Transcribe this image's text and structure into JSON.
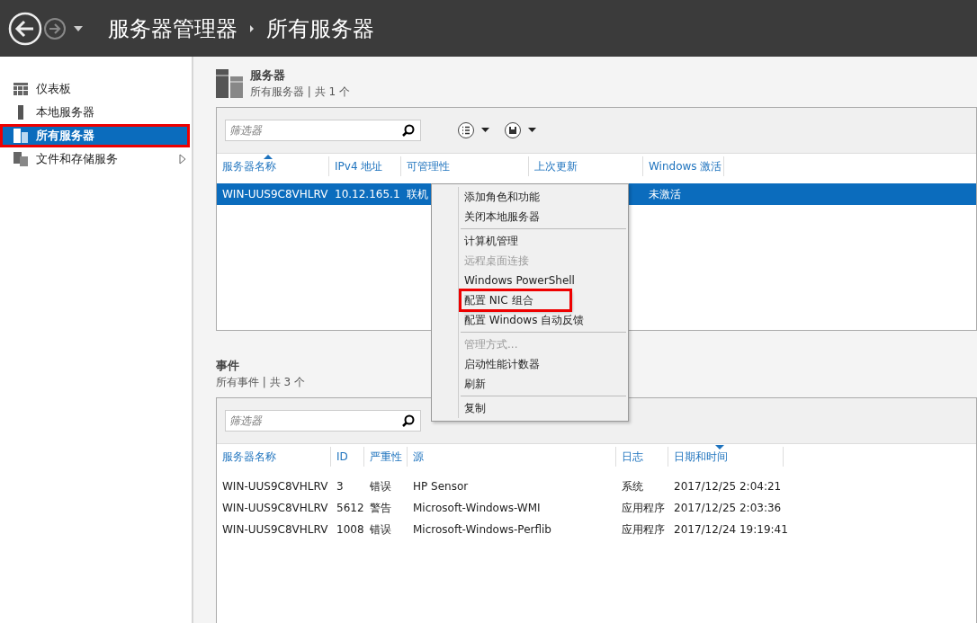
{
  "header": {
    "breadcrumb": [
      "服务器管理器",
      "所有服务器"
    ]
  },
  "sidebar": {
    "items": [
      {
        "label": "仪表板",
        "selected": false,
        "highlighted": false,
        "expandable": false
      },
      {
        "label": "本地服务器",
        "selected": false,
        "highlighted": false,
        "expandable": false
      },
      {
        "label": "所有服务器",
        "selected": true,
        "highlighted": true,
        "expandable": false
      },
      {
        "label": "文件和存储服务",
        "selected": false,
        "highlighted": false,
        "expandable": true
      }
    ]
  },
  "servers": {
    "title": "服务器",
    "subtitle": "所有服务器 | 共 1 个",
    "filter": {
      "placeholder": "筛选器"
    },
    "columns": [
      "服务器名称",
      "IPv4 地址",
      "可管理性",
      "上次更新",
      "Windows 激活"
    ],
    "rows": [
      {
        "cells": [
          "WIN-UUS9C8VHLRV",
          "10.12.165.1",
          "联机",
          "",
          "未激活"
        ],
        "selected": true
      }
    ]
  },
  "context_menu": {
    "groups": [
      [
        {
          "label": "添加角色和功能",
          "disabled": false,
          "highlighted": false
        },
        {
          "label": "关闭本地服务器",
          "disabled": false,
          "highlighted": false
        }
      ],
      [
        {
          "label": "计算机管理",
          "disabled": false,
          "highlighted": false
        },
        {
          "label": "远程桌面连接",
          "disabled": true,
          "highlighted": false
        },
        {
          "label": "Windows PowerShell",
          "disabled": false,
          "highlighted": false
        },
        {
          "label": "配置 NIC 组合",
          "disabled": false,
          "highlighted": true
        },
        {
          "label": "配置 Windows 自动反馈",
          "disabled": false,
          "highlighted": false
        }
      ],
      [
        {
          "label": "管理方式...",
          "disabled": true,
          "highlighted": false
        },
        {
          "label": "启动性能计数器",
          "disabled": false,
          "highlighted": false
        },
        {
          "label": "刷新",
          "disabled": false,
          "highlighted": false
        }
      ],
      [
        {
          "label": "复制",
          "disabled": false,
          "highlighted": false
        }
      ]
    ]
  },
  "events": {
    "title": "事件",
    "subtitle": "所有事件 | 共 3 个",
    "filter": {
      "placeholder": "筛选器"
    },
    "columns": [
      "服务器名称",
      "ID",
      "严重性",
      "源",
      "日志",
      "日期和时间"
    ],
    "rows": [
      {
        "cells": [
          "WIN-UUS9C8VHLRV",
          "3",
          "错误",
          "HP Sensor",
          "系统",
          "2017/12/25 2:04:21"
        ],
        "selected": false
      },
      {
        "cells": [
          "WIN-UUS9C8VHLRV",
          "5612",
          "警告",
          "Microsoft-Windows-WMI",
          "应用程序",
          "2017/12/25 2:03:36"
        ],
        "selected": false
      },
      {
        "cells": [
          "WIN-UUS9C8VHLRV",
          "1008",
          "错误",
          "Microsoft-Windows-Perflib",
          "应用程序",
          "2017/12/24 19:19:41"
        ],
        "selected": false
      }
    ]
  }
}
